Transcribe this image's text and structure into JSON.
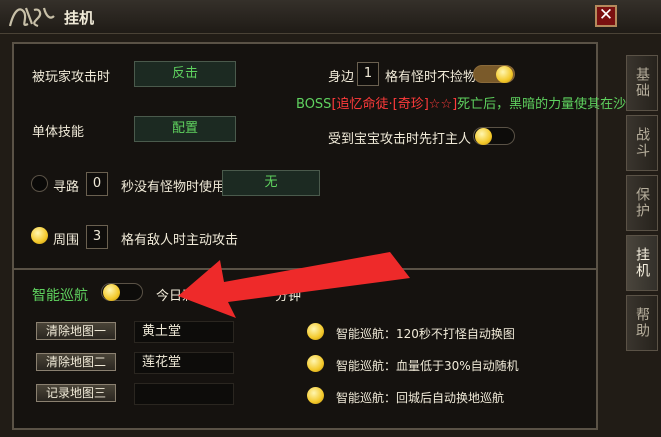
{
  "window": {
    "title": "挂机",
    "close_label": "✕"
  },
  "tabs": [
    {
      "label": "基础",
      "active": false
    },
    {
      "label": "战斗",
      "active": false
    },
    {
      "label": "保护",
      "active": false
    },
    {
      "label": "挂机",
      "active": true
    },
    {
      "label": "帮助",
      "active": false
    }
  ],
  "rows": {
    "attacked_label": "被玩家攻击时",
    "attacked_btn": "反击",
    "single_skill_label": "单体技能",
    "single_skill_btn": "配置",
    "nearby_prefix": "身边",
    "nearby_value": "1",
    "nearby_suffix": "格有怪时不捡物",
    "pet_attacked_label": "受到宝宝攻击时先打主人",
    "pathfind_label": "寻路",
    "pathfind_value": "0",
    "pathfind_suffix": "秒没有怪物时使用",
    "pathfind_btn": "无",
    "around_label": "周围",
    "around_value": "3",
    "around_suffix": "格有敌人时主动攻击"
  },
  "boss_notice": {
    "prefix": "BOSS",
    "name": "[追忆命徒·[奇珍]☆☆]",
    "suffix": "死亡后，黑暗的力量使其在沙漠"
  },
  "smart": {
    "label": "智能巡航",
    "today_text": "今日剩",
    "partial_text": "分钟",
    "maps": [
      {
        "button": "清除地图一",
        "value": "黄土堂"
      },
      {
        "button": "清除地图二",
        "value": "莲花堂"
      },
      {
        "button": "记录地图三",
        "value": ""
      }
    ],
    "options": [
      "智能巡航：120秒不打怪自动换图",
      "智能巡航：血量低于30%自动随机",
      "智能巡航：回城后自动换地巡航"
    ]
  },
  "colors": {
    "accent_green": "#5fd25f",
    "alert_red": "#ff3b3b",
    "arrow_red": "#ee2a2a"
  }
}
